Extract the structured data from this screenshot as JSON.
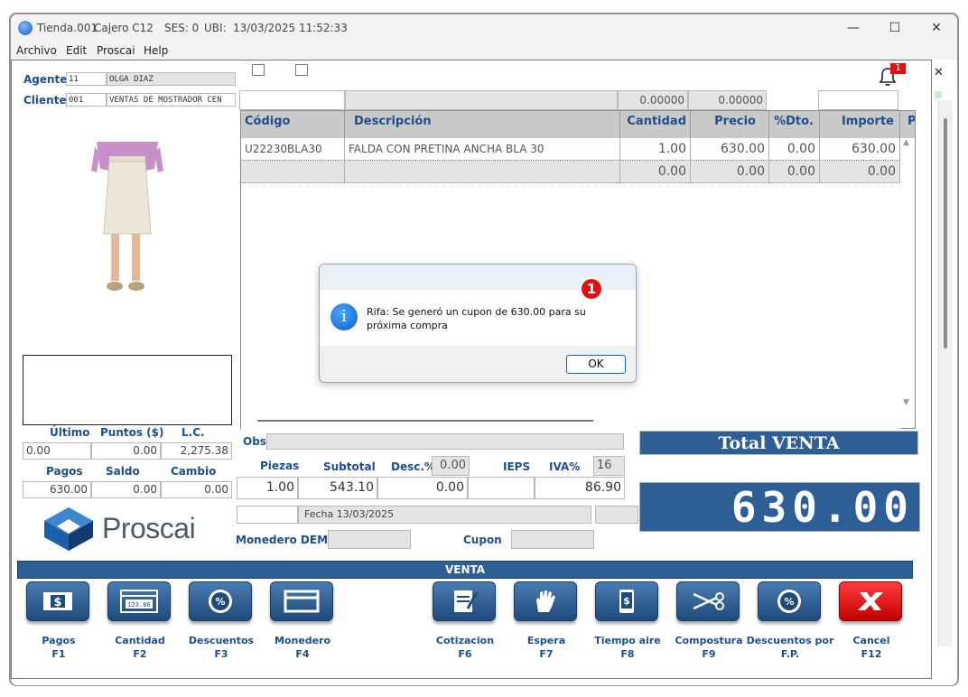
{
  "window": {
    "title_store": "Tienda.001",
    "title_cashier": "Cajero C12",
    "title_ses": "SES: 0",
    "title_ubi": "UBI:",
    "title_datetime": "13/03/2025 11:52:33",
    "minimize": "—",
    "maximize": "☐",
    "close": "✕"
  },
  "menu": [
    "Archivo",
    "Edit",
    "Proscai",
    "Help"
  ],
  "header": {
    "agente_label": "Agente",
    "agente_code": "11",
    "agente_name": "OLGA DIAZ",
    "cliente_label": "Cliente",
    "cliente_code": "001",
    "cliente_name": "VENTAS DE MOSTRADOR CEN",
    "top_val1": "0.00000",
    "top_val2": "0.00000",
    "notif_count": "1",
    "side_close": "✕"
  },
  "grid": {
    "headers": [
      "Código",
      "Descripción",
      "Cantidad",
      "Precio",
      "%Dto.",
      "Importe",
      "P"
    ],
    "rows": [
      {
        "codigo": "U22230BLA30",
        "descripcion": "FALDA CON PRETINA ANCHA BLA 30",
        "cantidad": "1.00",
        "precio": "630.00",
        "dto": "0.00",
        "importe": "630.00"
      },
      {
        "codigo": "",
        "descripcion": "",
        "cantidad": "0.00",
        "precio": "0.00",
        "dto": "0.00",
        "importe": "0.00"
      }
    ]
  },
  "dialog": {
    "message": "Rifa: Se generó un cupon de 630.00 para su próxima compra",
    "ok": "OK",
    "badge": "1",
    "info_glyph": "i"
  },
  "left_stats": {
    "ultimo_label": "Último",
    "puntos_label": "Puntos ($)",
    "lc_label": "L.C.",
    "ultimo": "0.00",
    "puntos": "0.00",
    "lc": "2,275.38",
    "pagos_label": "Pagos",
    "saldo_label": "Saldo",
    "cambio_label": "Cambio",
    "pagos": "630.00",
    "saldo": "0.00",
    "cambio": "0.00"
  },
  "totals": {
    "obs_label": "Obs",
    "piezas_label": "Piezas",
    "subtotal_label": "Subtotal",
    "desc_label": "Desc.%",
    "desc_pct": "0.00",
    "ieps_label": "IEPS",
    "iva_label": "IVA%",
    "iva_pct": "16",
    "piezas": "1.00",
    "subtotal": "543.10",
    "desc": "0.00",
    "ieps": "",
    "iva": "86.90",
    "fecha": "Fecha 13/03/2025",
    "monedero_label": "Monedero DEM",
    "cupon_label": "Cupon",
    "total_label": "Total VENTA",
    "total_value": "630.00"
  },
  "brand": {
    "logo_text": "Proscai"
  },
  "venta_bar": "VENTA",
  "fbuttons": [
    {
      "line1": "Pagos",
      "line2": "F1"
    },
    {
      "line1": "Cantidad",
      "line2": "F2"
    },
    {
      "line1": "Descuentos",
      "line2": "F3"
    },
    {
      "line1": "Monedero",
      "line2": "F4"
    },
    {
      "line1": "Cotizacion",
      "line2": "F6"
    },
    {
      "line1": "Espera",
      "line2": "F7"
    },
    {
      "line1": "Tiempo aire",
      "line2": "F8"
    },
    {
      "line1": "Compostura",
      "line2": "F9"
    },
    {
      "line1": "Descuentos por",
      "line2": "F.P."
    },
    {
      "line1": "Cancel",
      "line2": "F12"
    }
  ],
  "icon_text": {
    "cantidad_display": "123.86",
    "percent": "%"
  },
  "colors": {
    "accent_blue": "#2e5e96",
    "label_blue": "#1f4e8c",
    "cancel_red": "#e01111"
  }
}
